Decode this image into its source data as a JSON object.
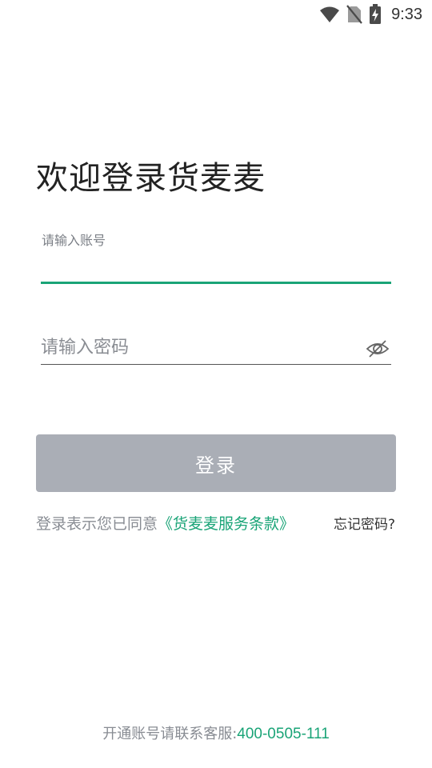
{
  "status_bar": {
    "time": "9:33",
    "icons": [
      "wifi-icon",
      "no-sim-icon",
      "battery-charging-icon"
    ]
  },
  "title": "欢迎登录货麦麦",
  "account": {
    "label": "请输入账号",
    "value": ""
  },
  "password": {
    "placeholder": "请输入密码",
    "value": "",
    "toggle_icon": "eye-off-icon"
  },
  "login_button": {
    "label": "登录",
    "color": "#aaaeb6"
  },
  "agreement": {
    "prefix": "登录表示您已同意",
    "link": "《货麦麦服务条款》"
  },
  "forgot_password": "忘记密码?",
  "footer": {
    "prefix": "开通账号请联系客服:",
    "phone": "400-0505-111"
  },
  "colors": {
    "accent": "#1aa477",
    "muted_text": "#888c93",
    "disabled_button": "#aaaeb6"
  }
}
